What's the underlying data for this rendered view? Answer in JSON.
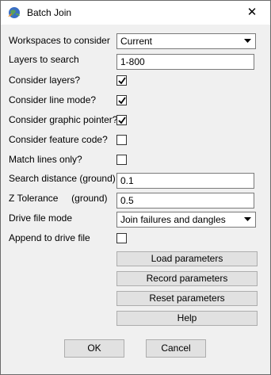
{
  "window": {
    "title": "Batch Join",
    "close_symbol": "✕"
  },
  "fields": {
    "workspaces": {
      "label": "Workspaces to consider",
      "value": "Current"
    },
    "layers": {
      "label": "Layers to search",
      "value": "1-800"
    },
    "consider_layers": {
      "label": "Consider layers?",
      "checked": true
    },
    "consider_line_mode": {
      "label": "Consider line mode?",
      "checked": true
    },
    "consider_graphic_pointer": {
      "label": "Consider graphic pointer?",
      "checked": true
    },
    "consider_feature_code": {
      "label": "Consider feature code?",
      "checked": false
    },
    "match_lines_only": {
      "label": "Match lines only?",
      "checked": false
    },
    "search_distance": {
      "label": "Search distance (ground)",
      "value": "0.1"
    },
    "z_tolerance": {
      "label": "Z Tolerance     (ground)",
      "value": "0.5"
    },
    "drive_file_mode": {
      "label": "Drive file mode",
      "value": "Join failures and dangles"
    },
    "append_to_drive": {
      "label": "Append to drive file",
      "checked": false
    }
  },
  "buttons": {
    "load": "Load parameters",
    "record": "Record parameters",
    "reset": "Reset parameters",
    "help": "Help",
    "ok": "OK",
    "cancel": "Cancel"
  }
}
